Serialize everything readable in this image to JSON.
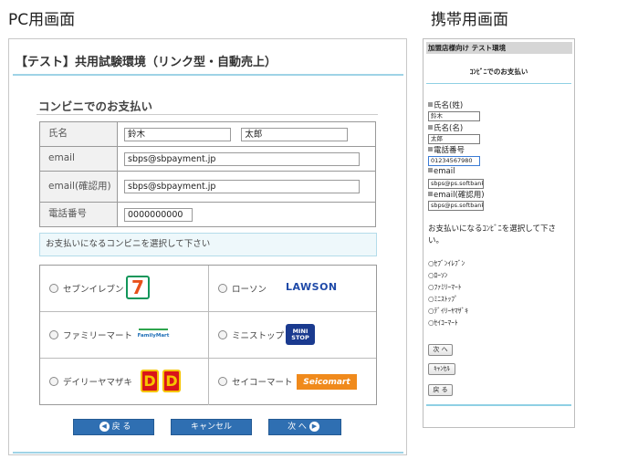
{
  "captions": {
    "pc": "PC用画面",
    "mobile": "携帯用画面"
  },
  "pc": {
    "title": "【テスト】共用試験環境（リンク型・自動売上）",
    "section": "コンビニでのお支払い",
    "fields": {
      "name_label": "氏名",
      "last_name": "鈴木",
      "first_name": "太郎",
      "email_label": "email",
      "email": "sbps@sbpayment.jp",
      "email_confirm_label": "email(確認用)",
      "email_confirm": "sbps@sbpayment.jp",
      "phone_label": "電話番号",
      "phone": "0000000000"
    },
    "notice": "お支払いになるコンビニを選択して下さい",
    "stores": [
      {
        "label": "セブンイレブン",
        "icon": "seven-eleven-logo",
        "logo_text": "7"
      },
      {
        "label": "ローソン",
        "icon": "lawson-logo",
        "logo_text": "LAWSON"
      },
      {
        "label": "ファミリーマート",
        "icon": "familymart-logo",
        "logo_text": "FamilyMart"
      },
      {
        "label": "ミニストップ",
        "icon": "ministop-logo",
        "logo_text": "MINI STOP"
      },
      {
        "label": "デイリーヤマザキ",
        "icon": "daily-yamazaki-logo",
        "logo_text": "D"
      },
      {
        "label": "セイコーマート",
        "icon": "seicomart-logo",
        "logo_text": "Seicomart"
      }
    ],
    "buttons": {
      "back": "戻 る",
      "cancel": "キャンセル",
      "next": "次 へ"
    },
    "accent_color": "#2f6fb2",
    "line_color": "#9fd3e6"
  },
  "mobile": {
    "header": "加盟店様向け テスト環境",
    "title": "ｺﾝﾋﾞﾆでのお支払い",
    "last_name_label": "氏名(姓)",
    "last_name": "鈴木",
    "first_name_label": "氏名(名)",
    "first_name": "太郎",
    "phone_label": "電話番号",
    "phone": "01234567980",
    "email_label": "email",
    "email": "sbps@ps.softbank.",
    "email_confirm_label": "email(確認用)",
    "email_confirm": "sbps@ps.softbank.",
    "select_text": "お支払いになるｺﾝﾋﾞﾆを選択して下さい。",
    "options": [
      "○ｾﾌﾞﾝｲﾚﾌﾞﾝ",
      "○ﾛｰｿﾝ",
      "○ﾌｧﾐﾘｰﾏｰﾄ",
      "○ﾐﾆｽﾄｯﾌﾟ",
      "○ﾃﾞｲﾘｰﾔﾏｻﾞｷ",
      "○ｾｲｺｰﾏｰﾄ"
    ],
    "buttons": {
      "next": "次 へ",
      "cancel": "ｷｬﾝｾﾙ",
      "back": "戻 る"
    }
  }
}
